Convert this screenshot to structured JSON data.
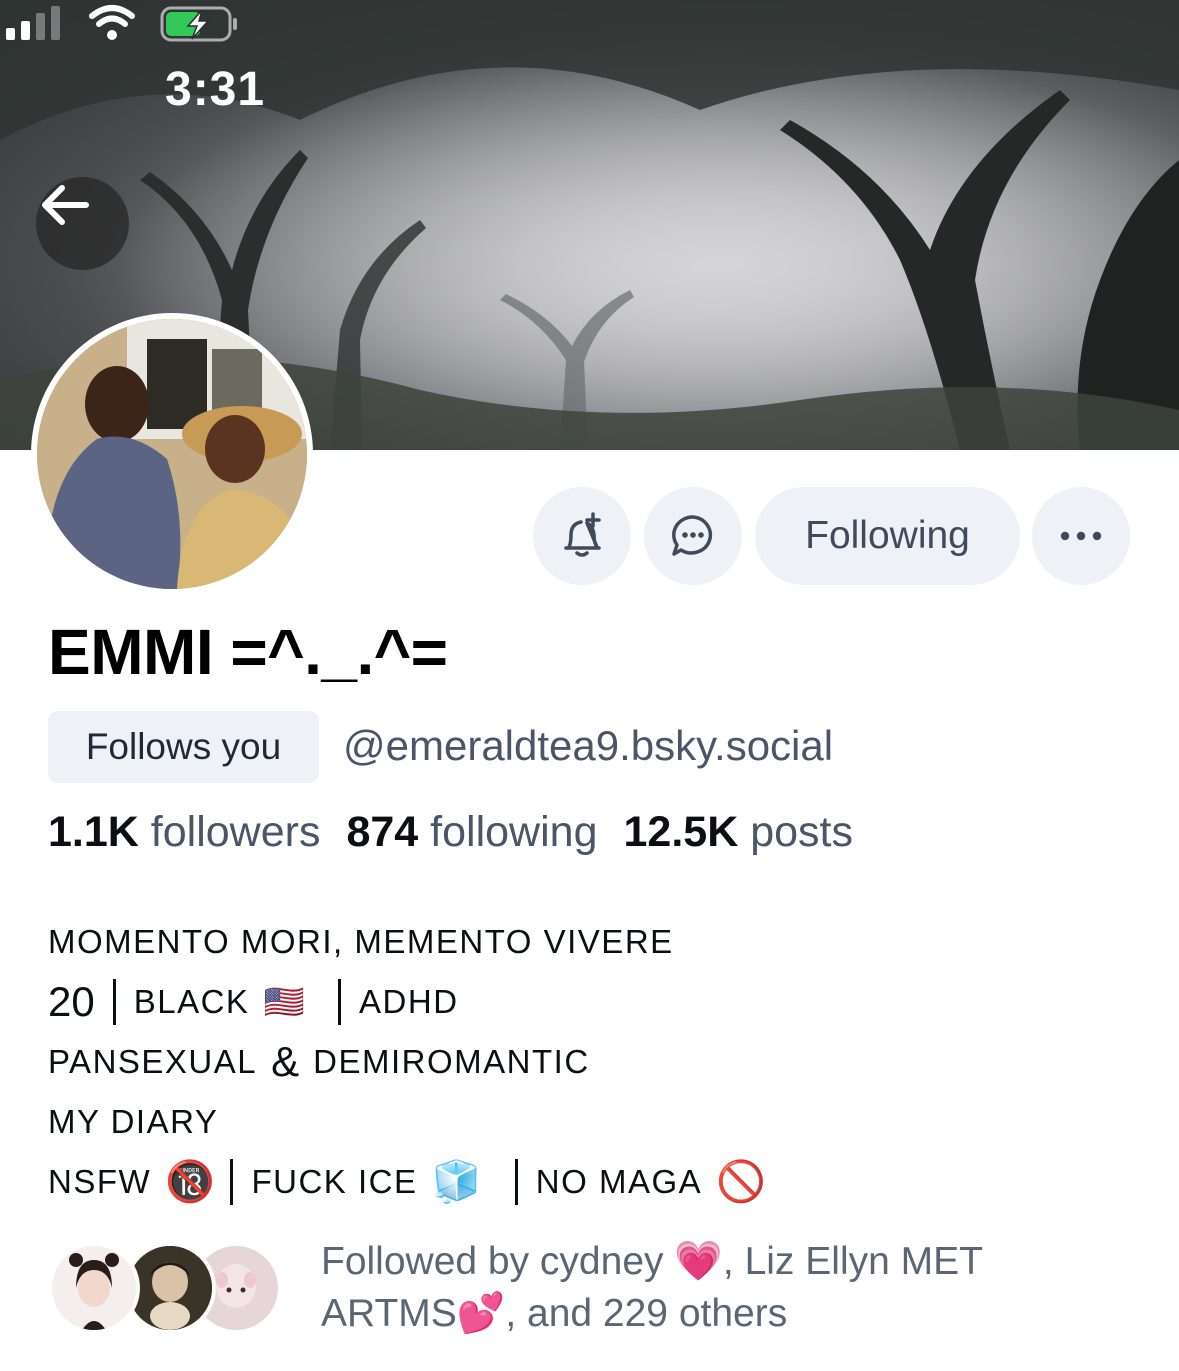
{
  "status_bar": {
    "time": "3:31",
    "icons": [
      "signal-icon",
      "wifi-icon",
      "battery-charging-icon"
    ],
    "battery_color": "#34c759"
  },
  "header": {
    "back_icon": "arrow-left-icon"
  },
  "actions": {
    "subscribe_icon": "bell-plus-icon",
    "message_icon": "chat-bubble-icon",
    "follow_label": "Following",
    "more_icon": "ellipsis-icon"
  },
  "profile": {
    "display_name": "EMMI =^._.^=",
    "follows_you": "Follows you",
    "handle": "@emeraldtea9.bsky.social"
  },
  "stats": {
    "followers_count": "1.1K",
    "followers_label": "followers",
    "following_count": "874",
    "following_label": "following",
    "posts_count": "12.5K",
    "posts_label": "posts"
  },
  "bio": {
    "line1": "MOMENTO MORI, MEMENTO VIVERE",
    "line2_a": "20",
    "line2_b": "BLACK",
    "line2_emoji": "🇺🇸",
    "line2_c": "ADHD",
    "line3_a": "PANSEXUAL",
    "line3_amp": "&",
    "line3_b": "DEMIROMANTIC",
    "line4": "MY DIARY",
    "line5_a": "NSFW",
    "line5_emoji1": "🔞",
    "line5_b": "FUCK ICE",
    "line5_emoji2": "🧊",
    "line5_c": "NO MAGA",
    "line5_emoji3": "🚫"
  },
  "followed_by": {
    "text_line1": "Followed by cydney 💗, Liz Ellyn MET",
    "text_line2": "ARTMS💕, and 229 others"
  },
  "colors": {
    "accent_bg": "#eef1f6",
    "muted_text": "#4a5568"
  }
}
